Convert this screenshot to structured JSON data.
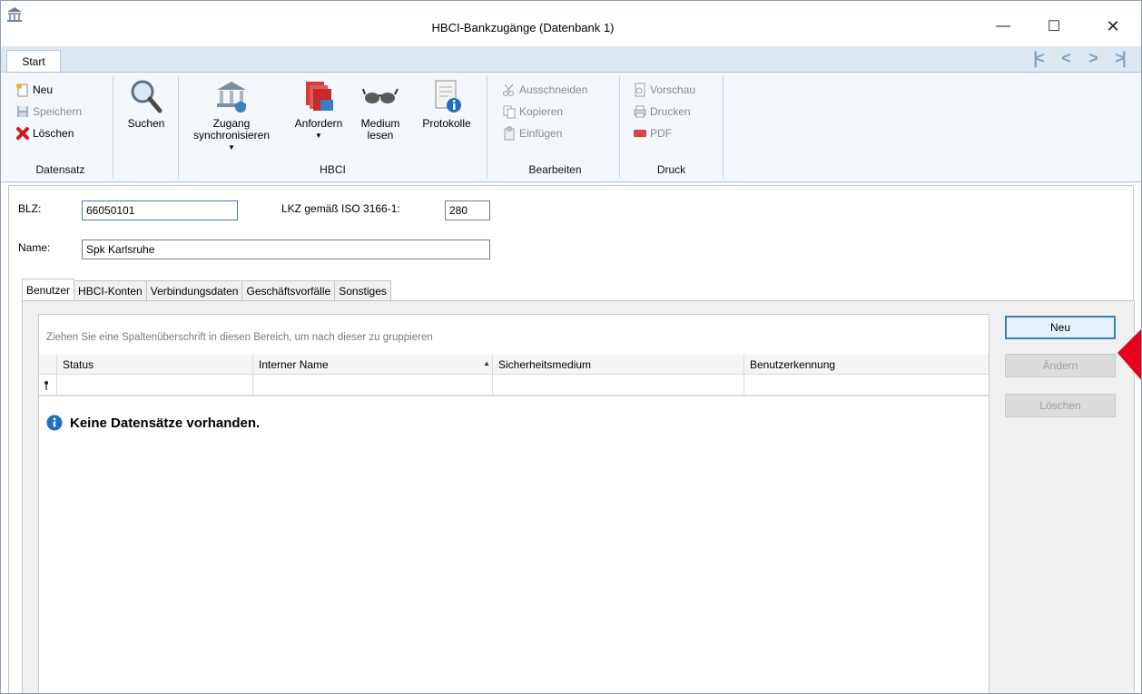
{
  "window": {
    "title": "HBCI-Bankzugänge (Datenbank 1)",
    "minimize": "—",
    "maximize": "☐",
    "close": "✕"
  },
  "ribbon": {
    "tab": "Start",
    "nav": [
      "|<",
      "<",
      ">",
      ">|"
    ],
    "groups": {
      "datensatz": {
        "label": "Datensatz",
        "neu": "Neu",
        "speichern": "Speichern",
        "loeschen": "Löschen"
      },
      "suchen": {
        "label": "Suchen"
      },
      "hbci": {
        "label": "HBCI",
        "zugang_line1": "Zugang",
        "zugang_line2": "synchronisieren",
        "anfordern": "Anfordern",
        "medium_line1": "Medium",
        "medium_line2": "lesen",
        "protokolle": "Protokolle"
      },
      "bearbeiten": {
        "label": "Bearbeiten",
        "ausschneiden": "Ausschneiden",
        "kopieren": "Kopieren",
        "einfuegen": "Einfügen"
      },
      "druck": {
        "label": "Druck",
        "vorschau": "Vorschau",
        "drucken": "Drucken",
        "pdf": "PDF"
      }
    }
  },
  "form": {
    "blz_label": "BLZ:",
    "blz_value": "66050101",
    "lkz_label": "LKZ gemäß ISO 3166-1:",
    "lkz_value": "280",
    "name_label": "Name:",
    "name_value": "Spk Karlsruhe"
  },
  "tabs": [
    "Benutzer",
    "HBCI-Konten",
    "Verbindungsdaten",
    "Geschäftsvorfälle",
    "Sonstiges"
  ],
  "grid": {
    "group_hint": "Ziehen Sie eine Spaltenüberschrift in diesen Bereich, um nach dieser zu gruppieren",
    "columns": [
      "Status",
      "Interner Name",
      "Sicherheitsmedium",
      "Benutzerkennung"
    ],
    "empty_message": "Keine Datensätze vorhanden."
  },
  "side_buttons": {
    "neu": "Neu",
    "aendern": "Ändern",
    "loeschen": "Löschen"
  },
  "colors": {
    "ribbon_bg": "#f4f7fb",
    "tab_row_bg": "#dde7f2",
    "focus_border": "#3c7fb1",
    "annotation": "#e8001c"
  }
}
